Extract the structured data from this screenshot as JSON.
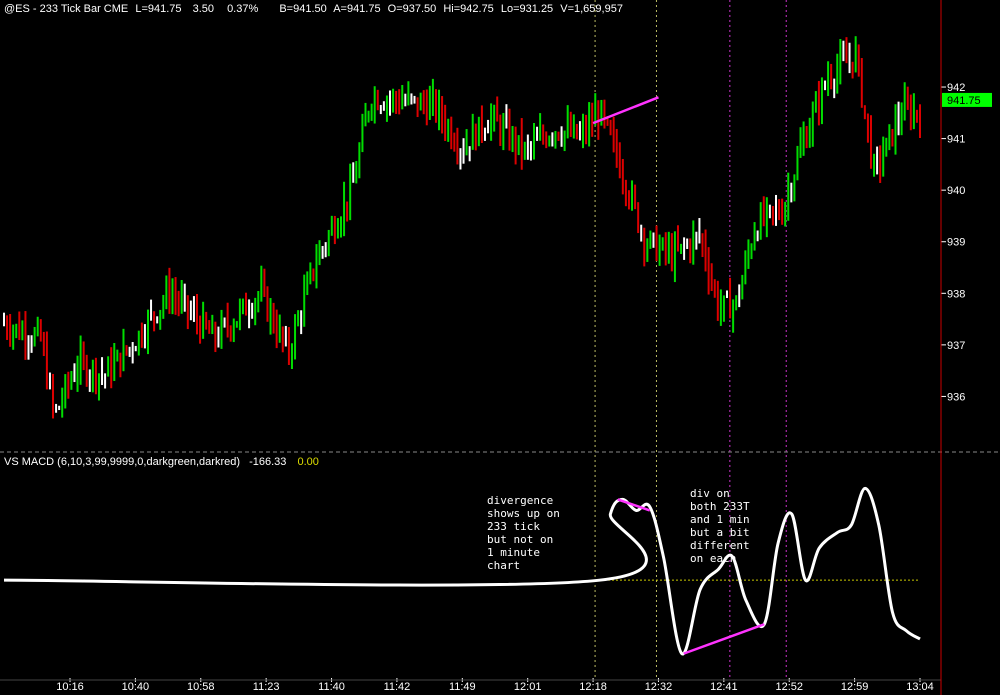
{
  "header": {
    "symbol": "@ES - 233 Tick Bar  CME",
    "last": "L=941.75",
    "change": "3.50",
    "pct": "0.37%",
    "bid": "B=941.50",
    "ask": "A=941.75",
    "open": "O=937.50",
    "high": "Hi=942.75",
    "low": "Lo=931.25",
    "volume": "V=1,659,957"
  },
  "indicator": {
    "label": "VS  MACD (6,10,3,99,9999,0,darkgreen,darkred)",
    "value": "-166.33",
    "value2": "0.00"
  },
  "colors": {
    "background": "#000000",
    "up_bar": "#00dd00",
    "down_bar": "#dd0000",
    "neutral_bar": "#ffffff",
    "macd_line": "#ffffff",
    "annotation": "#ff33ff",
    "last_price_tag": "#00ff00",
    "zero_line": "#cccc00",
    "divider": "#cc0000"
  },
  "annotations": [
    {
      "lines": [
        "divergence",
        "shows up on",
        "233 tick",
        "but not on",
        "1 minute",
        "chart"
      ]
    },
    {
      "lines": [
        "div on",
        "both 233T",
        "and 1 min",
        "but a bit",
        "different",
        "on each"
      ]
    }
  ],
  "chart_data": [
    {
      "type": "bar",
      "subtype": "ohlc-tick-bars",
      "xlabel": "",
      "ylabel": "",
      "x_ticks": [
        "10:16",
        "10:40",
        "10:58",
        "11:23",
        "11:40",
        "11:42",
        "11:49",
        "12:01",
        "12:18",
        "12:32",
        "12:41",
        "12:52",
        "12:59",
        "13:04"
      ],
      "y_ticks": [
        936,
        937,
        938,
        939,
        940,
        941,
        942
      ],
      "ylim": [
        935.0,
        943.3
      ],
      "last_price": 941.75,
      "last_price_label": "941.75",
      "close_path": [
        {
          "x": 0,
          "y": 937.4
        },
        {
          "x": 0.04,
          "y": 937.1
        },
        {
          "x": 0.055,
          "y": 935.6
        },
        {
          "x": 0.08,
          "y": 936.6
        },
        {
          "x": 0.11,
          "y": 936.4
        },
        {
          "x": 0.14,
          "y": 937.0
        },
        {
          "x": 0.18,
          "y": 938.0
        },
        {
          "x": 0.23,
          "y": 937.1
        },
        {
          "x": 0.28,
          "y": 938.0
        },
        {
          "x": 0.31,
          "y": 936.8
        },
        {
          "x": 0.34,
          "y": 938.6
        },
        {
          "x": 0.38,
          "y": 940.0
        },
        {
          "x": 0.4,
          "y": 941.8
        },
        {
          "x": 0.44,
          "y": 941.7
        },
        {
          "x": 0.47,
          "y": 941.6
        },
        {
          "x": 0.5,
          "y": 940.8
        },
        {
          "x": 0.53,
          "y": 941.4
        },
        {
          "x": 0.57,
          "y": 940.7
        },
        {
          "x": 0.6,
          "y": 941.2
        },
        {
          "x": 0.63,
          "y": 941.0
        },
        {
          "x": 0.65,
          "y": 941.5
        },
        {
          "x": 0.67,
          "y": 940.6
        },
        {
          "x": 0.7,
          "y": 939.0
        },
        {
          "x": 0.73,
          "y": 938.7
        },
        {
          "x": 0.76,
          "y": 939.1
        },
        {
          "x": 0.78,
          "y": 937.7
        },
        {
          "x": 0.8,
          "y": 937.8
        },
        {
          "x": 0.82,
          "y": 939.3
        },
        {
          "x": 0.85,
          "y": 939.6
        },
        {
          "x": 0.87,
          "y": 940.8
        },
        {
          "x": 0.9,
          "y": 942.2
        },
        {
          "x": 0.93,
          "y": 942.6
        },
        {
          "x": 0.95,
          "y": 940.3
        },
        {
          "x": 0.98,
          "y": 941.5
        },
        {
          "x": 1.0,
          "y": 941.5
        }
      ],
      "vertical_markers": [
        "12:18",
        "12:32",
        "12:41",
        "12:52"
      ],
      "trendline": {
        "from": {
          "time": "12:18",
          "price": 941.3
        },
        "to": {
          "time": "12:32",
          "price": 941.8
        }
      }
    },
    {
      "type": "line",
      "title": "VS  MACD (6,10,3,99,9999,0,darkgreen,darkred)",
      "series": [
        {
          "values": [
            {
              "x": 0,
              "y": 0
            },
            {
              "x": 0.65,
              "y": 0
            },
            {
              "x": 0.662,
              "y": 0.72
            },
            {
              "x": 0.675,
              "y": 0.88
            },
            {
              "x": 0.69,
              "y": 0.76
            },
            {
              "x": 0.705,
              "y": 0.8
            },
            {
              "x": 0.72,
              "y": 0.25
            },
            {
              "x": 0.74,
              "y": -0.8
            },
            {
              "x": 0.76,
              "y": -0.1
            },
            {
              "x": 0.78,
              "y": 0.12
            },
            {
              "x": 0.795,
              "y": 0.26
            },
            {
              "x": 0.81,
              "y": -0.22
            },
            {
              "x": 0.83,
              "y": -0.48
            },
            {
              "x": 0.845,
              "y": 0.4
            },
            {
              "x": 0.86,
              "y": 0.72
            },
            {
              "x": 0.875,
              "y": 0.0
            },
            {
              "x": 0.89,
              "y": 0.35
            },
            {
              "x": 0.91,
              "y": 0.52
            },
            {
              "x": 0.925,
              "y": 0.6
            },
            {
              "x": 0.94,
              "y": 1.0
            },
            {
              "x": 0.955,
              "y": 0.6
            },
            {
              "x": 0.97,
              "y": -0.35
            },
            {
              "x": 0.985,
              "y": -0.55
            },
            {
              "x": 1.0,
              "y": -0.64
            }
          ]
        }
      ],
      "zero_line": 0,
      "ylim": [
        -1.0,
        1.2
      ],
      "trendlines": [
        {
          "from": {
            "x": 0.67,
            "y": 0.88
          },
          "to": {
            "x": 0.705,
            "y": 0.76
          }
        },
        {
          "from": {
            "x": 0.742,
            "y": -0.8
          },
          "to": {
            "x": 0.83,
            "y": -0.48
          }
        }
      ]
    }
  ]
}
